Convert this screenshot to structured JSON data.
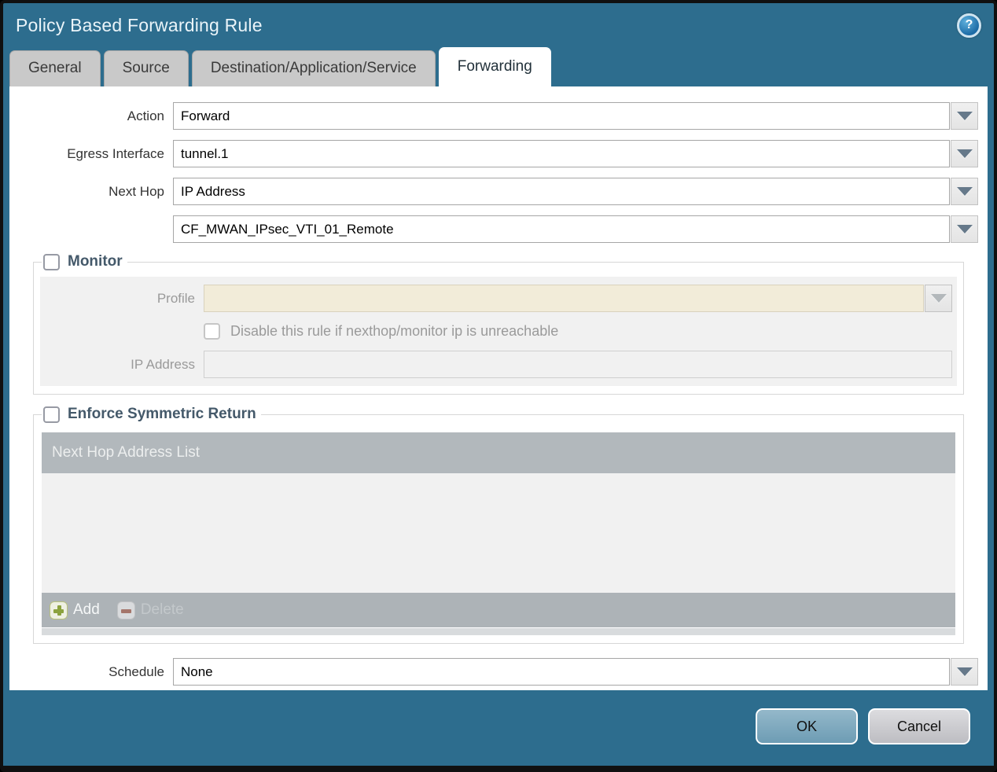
{
  "dialog": {
    "title": "Policy Based Forwarding Rule"
  },
  "tabs": [
    {
      "label": "General"
    },
    {
      "label": "Source"
    },
    {
      "label": "Destination/Application/Service"
    },
    {
      "label": "Forwarding"
    }
  ],
  "form": {
    "action": {
      "label": "Action",
      "value": "Forward"
    },
    "egress_interface": {
      "label": "Egress Interface",
      "value": "tunnel.1"
    },
    "next_hop": {
      "label": "Next Hop",
      "value": "IP Address"
    },
    "next_hop_address": {
      "value": "CF_MWAN_IPsec_VTI_01_Remote"
    },
    "schedule": {
      "label": "Schedule",
      "value": "None"
    }
  },
  "monitor": {
    "label": "Monitor",
    "checked": false,
    "profile": {
      "label": "Profile",
      "value": ""
    },
    "disable_rule": {
      "label": "Disable this rule if nexthop/monitor ip is unreachable",
      "checked": false
    },
    "ip_address": {
      "label": "IP Address",
      "value": ""
    }
  },
  "enforce_symmetric_return": {
    "label": "Enforce Symmetric Return",
    "checked": false,
    "list": {
      "header": "Next Hop Address List",
      "rows": [],
      "add_label": "Add",
      "delete_label": "Delete"
    }
  },
  "footer": {
    "ok_label": "OK",
    "cancel_label": "Cancel"
  },
  "icons": {
    "help": "help-icon",
    "help_glyph": "?",
    "dropdown": "chevron-down-icon",
    "add": "plus-icon",
    "delete": "minus-icon"
  },
  "colors": {
    "chrome_teal": "#2d6d8e",
    "active_tab": "#ffffff",
    "inactive_tab": "#c9c9c9",
    "list_header": "#b2b8bc",
    "list_footer": "#adb3b7",
    "disabled_field_cream": "#f2ecd9",
    "panel_gray": "#f1f1f1",
    "legend_slate": "#44596a",
    "ok_button": "#7fa9bd",
    "cancel_button": "#c9c9cd",
    "add_plus_green": "#8ba23e",
    "delete_minus_red": "#a5766b"
  }
}
